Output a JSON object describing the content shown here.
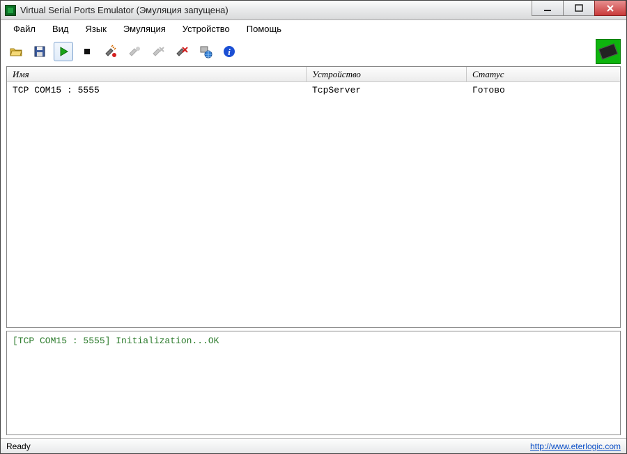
{
  "title": "Virtual Serial Ports Emulator (Эмуляция запущена)",
  "menu": {
    "file": "Файл",
    "view": "Вид",
    "language": "Язык",
    "emulation": "Эмуляция",
    "device": "Устройство",
    "help": "Помощь"
  },
  "toolbar_icons": {
    "open": "open-icon",
    "save": "save-icon",
    "play": "play-icon",
    "stop": "stop-icon",
    "add": "add-device-icon",
    "add2": "add-device2-icon",
    "remove": "remove-device-icon",
    "delete": "delete-device-icon",
    "net": "network-icon",
    "info": "info-icon",
    "hw": "hardware-icon"
  },
  "columns": {
    "name": "Имя",
    "device": "Устройство",
    "status": "Статус"
  },
  "rows": [
    {
      "name": "TCP COM15 : 5555",
      "device": "TcpServer",
      "status": "Готово"
    }
  ],
  "log_line": "[TCP COM15 : 5555] Initialization...OK",
  "status": {
    "ready": "Ready",
    "link": "http://www.eterlogic.com"
  }
}
